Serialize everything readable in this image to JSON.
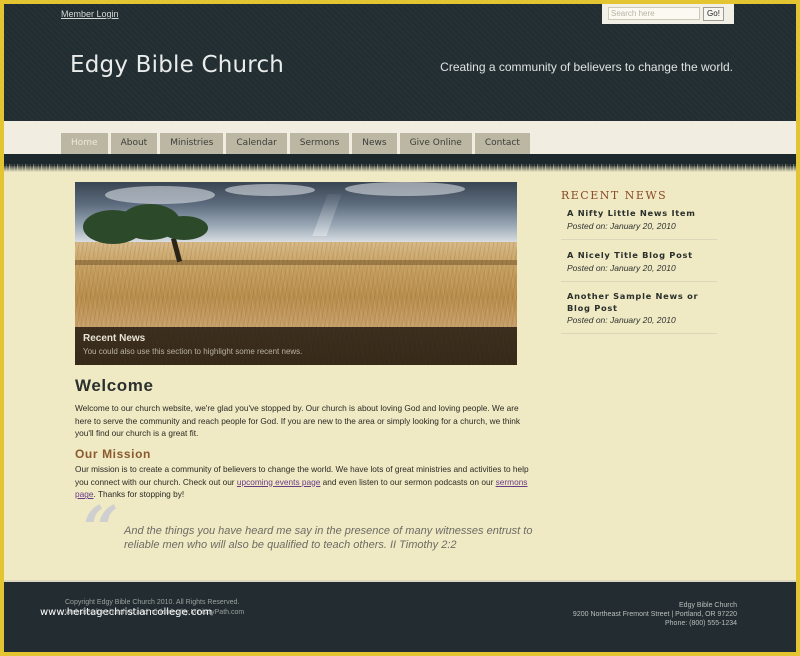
{
  "header": {
    "member_login": "Member Login",
    "search": {
      "placeholder": "Search here",
      "value": "",
      "button_label": "Go!"
    },
    "site_title": "Edgy Bible Church",
    "tagline": "Creating a community of believers to change the world."
  },
  "nav": {
    "active": "Home",
    "items": [
      {
        "label": "Home"
      },
      {
        "label": "About"
      },
      {
        "label": "Ministries"
      },
      {
        "label": "Calendar"
      },
      {
        "label": "Sermons"
      },
      {
        "label": "News"
      },
      {
        "label": "Give Online"
      },
      {
        "label": "Contact"
      }
    ]
  },
  "hero": {
    "image": "landscape-tree-field-storm",
    "caption_title": "Recent News",
    "caption_text": "You could also use this section to highlight some recent news."
  },
  "main": {
    "welcome_title": "Welcome",
    "welcome_text": "Welcome to our church website, we're glad you've stopped by. Our church is about loving God and loving people. We are here to serve the community and reach people for God. If you are new to the area or simply looking for a church, we think you'll find our church is a great fit.",
    "mission_title": "Our Mission",
    "mission_text_1": "Our mission is to create a community of believers to change the world. We have lots of great ministries and activities to help you connect with our church. Check out our ",
    "mission_link_1": "upcoming events page",
    "mission_text_2": " and even listen to our sermon podcasts on our ",
    "mission_link_2": "sermons page",
    "mission_text_3": ". Thanks for stopping by!",
    "quote_mark": "“",
    "quote": "And the things you have heard me say in the presence of many witnesses entrust to reliable men who will also be qualified to teach others. II Timothy 2:2"
  },
  "sidebar": {
    "title": "RECENT NEWS",
    "items": [
      {
        "title": "A Nifty Little News Item",
        "date": "Posted on: January 20, 2010"
      },
      {
        "title": "A Nicely Title Blog Post",
        "date": "Posted on: January 20, 2010"
      },
      {
        "title": "Another Sample News or Blog Post",
        "date": "Posted on: January 20, 2010"
      }
    ]
  },
  "footer": {
    "copyright": "Copyright Edgy Bible Church 2010. All Rights Reserved.",
    "credit": "Websites for churches and ministries by MinistryPath.com",
    "watermark": "www.heritagechristiancollege.com",
    "address_name": "Edgy Bible Church",
    "address_line": "9200 Northeast Fremont Street | Portland, OR 97220",
    "phone": "Phone: (800) 555-1234"
  },
  "colors": {
    "border": "#e2c530",
    "header_bg": "#232e33",
    "page_bg": "#efe9c4",
    "nav_tab": "#bcb7a2",
    "accent_heading": "#8a5a2e",
    "link": "#6a3a88"
  }
}
